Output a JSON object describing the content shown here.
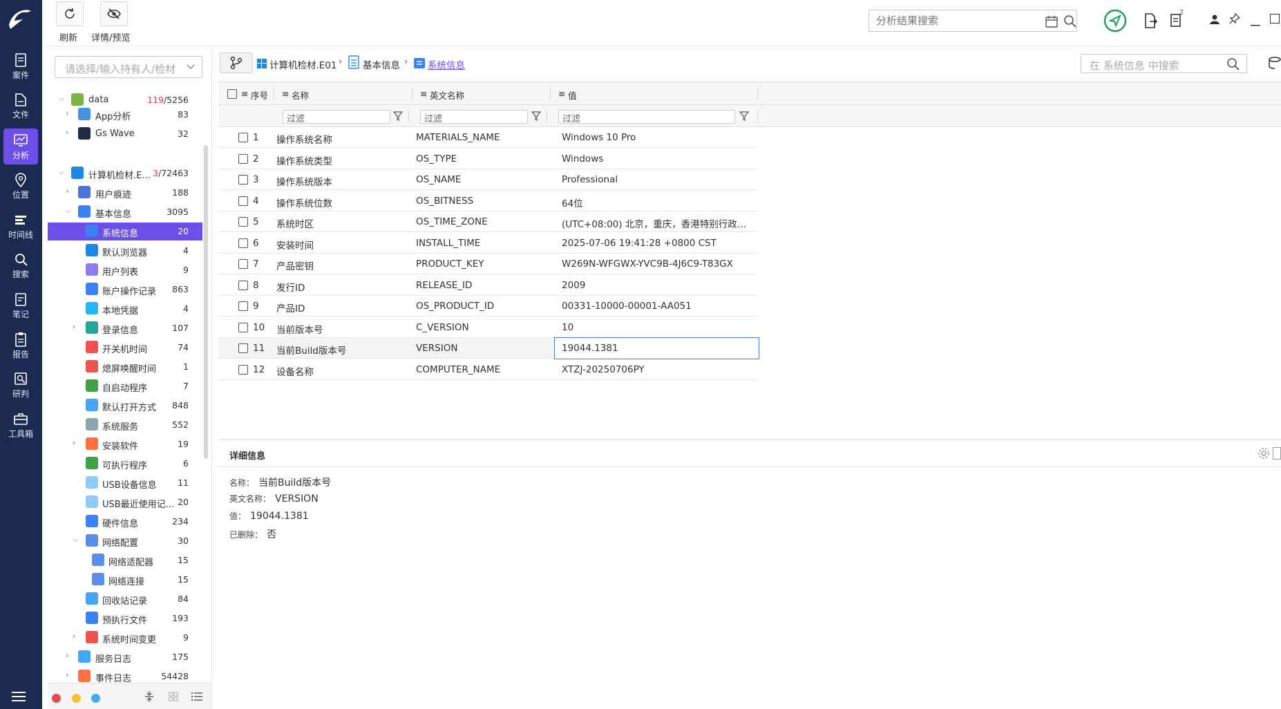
{
  "toolbar": {
    "refresh_label": "刷新",
    "detail_preview_label": "详情/预览",
    "search_placeholder": "分析结果搜索",
    "notification_count": "2"
  },
  "rail": {
    "items": [
      {
        "label": "案件",
        "icon": "case-icon"
      },
      {
        "label": "文件",
        "icon": "file-icon"
      },
      {
        "label": "分析",
        "icon": "analysis-icon",
        "active": true
      },
      {
        "label": "位置",
        "icon": "location-icon"
      },
      {
        "label": "时间线",
        "icon": "timeline-icon"
      },
      {
        "label": "搜索",
        "icon": "search-icon"
      },
      {
        "label": "笔记",
        "icon": "notes-icon"
      },
      {
        "label": "报告",
        "icon": "report-icon"
      },
      {
        "label": "研判",
        "icon": "judge-icon"
      },
      {
        "label": "工具箱",
        "icon": "toolbox-icon"
      }
    ]
  },
  "sidebar": {
    "owner_placeholder": "请选择/输入持有人/检材",
    "tree": [
      {
        "label": "data",
        "count_red": "119",
        "count": "/5256"
      },
      {
        "label": "App分析",
        "count": "83"
      },
      {
        "label": "Gs Wave",
        "count": "32"
      },
      {
        "label": "计算机检材.E...",
        "count_red": "3",
        "count": "/72463"
      },
      {
        "label": "用户痕迹",
        "count": "188"
      },
      {
        "label": "基本信息",
        "count": "3095"
      },
      {
        "label": "系统信息",
        "count": "20"
      },
      {
        "label": "默认浏览器",
        "count": "4"
      },
      {
        "label": "用户列表",
        "count": "9"
      },
      {
        "label": "账户操作记录",
        "count": "863"
      },
      {
        "label": "本地凭据",
        "count": "4"
      },
      {
        "label": "登录信息",
        "count": "107"
      },
      {
        "label": "开关机时间",
        "count": "74"
      },
      {
        "label": "熄屏唤醒时间",
        "count": "1"
      },
      {
        "label": "自启动程序",
        "count": "7"
      },
      {
        "label": "默认打开方式",
        "count": "848"
      },
      {
        "label": "系统服务",
        "count": "552"
      },
      {
        "label": "安装软件",
        "count": "19"
      },
      {
        "label": "可执行程序",
        "count": "6"
      },
      {
        "label": "USB设备信息",
        "count": "11"
      },
      {
        "label": "USB最近使用记...",
        "count": "20"
      },
      {
        "label": "硬件信息",
        "count": "234"
      },
      {
        "label": "网络配置",
        "count": "30"
      },
      {
        "label": "网络适配器",
        "count": "15"
      },
      {
        "label": "网络连接",
        "count": "15"
      },
      {
        "label": "回收站记录",
        "count": "84"
      },
      {
        "label": "预执行文件",
        "count": "193"
      },
      {
        "label": "系统时间变更",
        "count": "9"
      },
      {
        "label": "服务日志",
        "count": "175"
      },
      {
        "label": "事件日志",
        "count": "54428"
      }
    ]
  },
  "breadcrumb": {
    "items": [
      "计算机检材.E01",
      "基本信息",
      "系统信息"
    ],
    "search_placeholder": "在 系统信息 中搜索"
  },
  "table": {
    "headers": {
      "index": "序号",
      "name": "名称",
      "english_name": "英文名称",
      "value": "值"
    },
    "filter_placeholder": "过滤",
    "rows": [
      {
        "n": "1",
        "name": "操作系统名称",
        "en": "MATERIALS_NAME",
        "value": "Windows 10 Pro"
      },
      {
        "n": "2",
        "name": "操作系统类型",
        "en": "OS_TYPE",
        "value": "Windows"
      },
      {
        "n": "3",
        "name": "操作系统版本",
        "en": "OS_NAME",
        "value": "Professional"
      },
      {
        "n": "4",
        "name": "操作系统位数",
        "en": "OS_BITNESS",
        "value": "64位"
      },
      {
        "n": "5",
        "name": "系统时区",
        "en": "OS_TIME_ZONE",
        "value": "(UTC+08:00) 北京，重庆，香港特别行政区..."
      },
      {
        "n": "6",
        "name": "安装时间",
        "en": "INSTALL_TIME",
        "value": "2025-07-06 19:41:28 +0800 CST"
      },
      {
        "n": "7",
        "name": "产品密钥",
        "en": "PRODUCT_KEY",
        "value": "W269N-WFGWX-YVC9B-4J6C9-T83GX"
      },
      {
        "n": "8",
        "name": "发行ID",
        "en": "RELEASE_ID",
        "value": "2009"
      },
      {
        "n": "9",
        "name": "产品ID",
        "en": "OS_PRODUCT_ID",
        "value": "00331-10000-00001-AA051"
      },
      {
        "n": "10",
        "name": "当前版本号",
        "en": "C_VERSION",
        "value": "10"
      },
      {
        "n": "11",
        "name": "当前Build版本号",
        "en": "VERSION",
        "value": "19044.1381"
      },
      {
        "n": "12",
        "name": "设备名称",
        "en": "COMPUTER_NAME",
        "value": "XTZJ-20250706PY"
      }
    ]
  },
  "detail": {
    "title": "详细信息",
    "name_key": "名称：",
    "name_val": "当前Build版本号",
    "en_key": "英文名称：",
    "en_val": "VERSION",
    "value_key": "值：",
    "value_val": "19044.1381",
    "deleted_key": "已删除：",
    "deleted_val": "否"
  }
}
